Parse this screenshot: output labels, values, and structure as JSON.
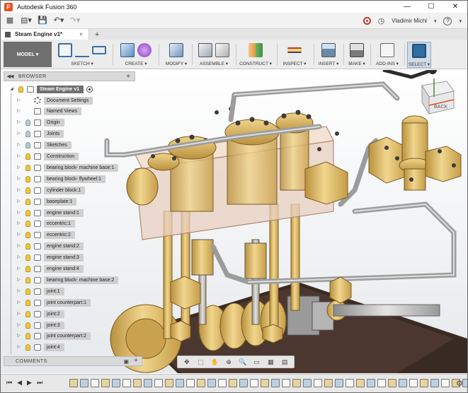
{
  "window": {
    "title": "Autodesk Fusion 360",
    "controls": [
      "—",
      "☐",
      "✕"
    ]
  },
  "qat": {
    "user": "Vladimir Michl",
    "help": "?"
  },
  "tabs": [
    {
      "label": "Steam Engine v1*",
      "close": "×"
    }
  ],
  "new_tab": "+",
  "toolbar": {
    "workspace": "MODEL ▾",
    "groups": [
      "SKETCH ▾",
      "CREATE ▾",
      "MODIFY ▾",
      "ASSEMBLE ▾",
      "CONSTRUCT ▾",
      "INSPECT ▾",
      "INSERT ▾",
      "MAKE ▾",
      "ADD-INS ▾",
      "SELECT ▾"
    ]
  },
  "browser": {
    "header": "BROWSER",
    "collapse": "◀◀",
    "plus": "+",
    "root": "Steam Engine v1",
    "items": [
      {
        "label": "Document Settings",
        "bulb": "none",
        "glyph": "gear"
      },
      {
        "label": "Named Views",
        "bulb": "none",
        "glyph": "fold"
      },
      {
        "label": "Origin",
        "bulb": "dim",
        "glyph": "fold"
      },
      {
        "label": "Joints",
        "bulb": "dim",
        "glyph": "fold"
      },
      {
        "label": "Sketches",
        "bulb": "dim",
        "glyph": "fold"
      },
      {
        "label": "Construction",
        "bulb": "on",
        "glyph": "fold"
      },
      {
        "label": "bearing block- machine base:1",
        "bulb": "on",
        "glyph": "comp"
      },
      {
        "label": "bearing block- flywheel:1",
        "bulb": "on",
        "glyph": "comp"
      },
      {
        "label": "cylinder block:1",
        "bulb": "on",
        "glyph": "comp"
      },
      {
        "label": "baseplate:1",
        "bulb": "on",
        "glyph": "comp"
      },
      {
        "label": "engine stand:1",
        "bulb": "on",
        "glyph": "comp"
      },
      {
        "label": "eccentric:1",
        "bulb": "on",
        "glyph": "comp"
      },
      {
        "label": "eccentric:2",
        "bulb": "on",
        "glyph": "comp"
      },
      {
        "label": "engine stand:2",
        "bulb": "on",
        "glyph": "comp"
      },
      {
        "label": "engine stand:3",
        "bulb": "on",
        "glyph": "comp"
      },
      {
        "label": "engine stand:4",
        "bulb": "on",
        "glyph": "comp"
      },
      {
        "label": "bearing block- machine base:2",
        "bulb": "on",
        "glyph": "comp"
      },
      {
        "label": "joint:1",
        "bulb": "on",
        "glyph": "comp"
      },
      {
        "label": "joint counterpart:1",
        "bulb": "on",
        "glyph": "comp"
      },
      {
        "label": "joint:2",
        "bulb": "on",
        "glyph": "comp"
      },
      {
        "label": "joint:3",
        "bulb": "on",
        "glyph": "comp"
      },
      {
        "label": "joint counterpart:2",
        "bulb": "on",
        "glyph": "comp"
      },
      {
        "label": "joint:4",
        "bulb": "on",
        "glyph": "comp"
      }
    ]
  },
  "comments": {
    "label": "COMMENTS",
    "plus": "+"
  },
  "viewcube": {
    "label": "BACK"
  },
  "timeline": {
    "controls": [
      "⏮",
      "◀",
      "▶",
      "⏭"
    ]
  },
  "colors": {
    "brass": "#d8b860",
    "steel": "#b9b9b9",
    "accent": "#e8501d"
  }
}
